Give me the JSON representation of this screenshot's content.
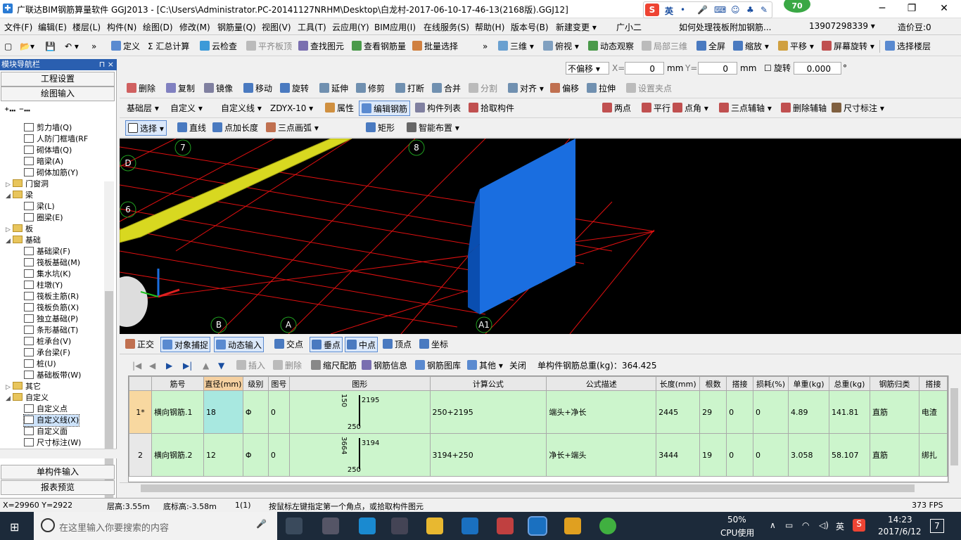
{
  "window": {
    "title": "广联达BIM钢筋算量软件 GGJ2013 - [C:\\Users\\Administrator.PC-20141127NRHM\\Desktop\\白龙村-2017-06-10-17-46-13(2168版).GGJ12]",
    "min": "─",
    "max": "❐",
    "close": "✕",
    "ime_logo": "S",
    "ime_lang": "英",
    "badge": "70"
  },
  "menu": [
    "文件(F)",
    "编辑(E)",
    "楼层(L)",
    "构件(N)",
    "绘图(D)",
    "修改(M)",
    "钢筋量(Q)",
    "视图(V)",
    "工具(T)",
    "云应用(Y)",
    "BIM应用(I)",
    "在线服务(S)",
    "帮助(H)",
    "版本号(B)",
    "新建变更 ▾",
    "广小二",
    "如何处理筏板附加钢筋...",
    "13907298339 ▾",
    "造价豆:0"
  ],
  "toolbar1": [
    "定义",
    "Σ 汇总计算",
    "云检查",
    "平齐板顶",
    "查找图元",
    "查看钢筋量",
    "批量选择",
    "三维 ▾",
    "俯视 ▾",
    "动态观察",
    "局部三维",
    "全屏",
    "缩放 ▾",
    "平移 ▾",
    "屏幕旋转 ▾",
    "选择楼层"
  ],
  "toolbar2": {
    "offset": "不偏移 ▾",
    "x_label": "X=",
    "x_val": "0",
    "y_label": "Y=",
    "y_val": "0",
    "unit": "mm",
    "rotate_label": "旋转",
    "rotate_val": "0.000",
    "deg": "°"
  },
  "toolbar3": [
    "删除",
    "复制",
    "镜像",
    "移动",
    "旋转",
    "延伸",
    "修剪",
    "打断",
    "合并",
    "分割",
    "对齐 ▾",
    "偏移",
    "拉伸",
    "设置夹点"
  ],
  "toolbar4": {
    "layer": "基础层",
    "type": "自定义",
    "sub": "自定义线",
    "code": "ZDYX-10",
    "items": [
      "属性",
      "编辑钢筋",
      "构件列表",
      "拾取构件",
      "两点",
      "平行",
      "点角 ▾",
      "三点辅轴 ▾",
      "删除辅轴",
      "尺寸标注 ▾"
    ]
  },
  "toolbar5": [
    "选择 ▾",
    "直线",
    "点加长度",
    "三点画弧 ▾",
    "矩形",
    "智能布置 ▾"
  ],
  "nav": {
    "title": "模块导航栏",
    "pin": "⊓ ×",
    "setup": "工程设置",
    "draw": "绘图输入",
    "single": "单构件输入",
    "report": "报表预览",
    "tree": [
      {
        "label": "剪力墙(Q)",
        "level": 2,
        "type": "item"
      },
      {
        "label": "人防门框墙(RF",
        "level": 2,
        "type": "item"
      },
      {
        "label": "砌体墙(Q)",
        "level": 2,
        "type": "item"
      },
      {
        "label": "暗梁(A)",
        "level": 2,
        "type": "item"
      },
      {
        "label": "砌体加筋(Y)",
        "level": 2,
        "type": "item"
      },
      {
        "label": "门窗洞",
        "level": 1,
        "type": "folder",
        "tw": "▷"
      },
      {
        "label": "梁",
        "level": 1,
        "type": "folder",
        "tw": "◢"
      },
      {
        "label": "梁(L)",
        "level": 2,
        "type": "item"
      },
      {
        "label": "圈梁(E)",
        "level": 2,
        "type": "item"
      },
      {
        "label": "板",
        "level": 1,
        "type": "folder",
        "tw": "▷"
      },
      {
        "label": "基础",
        "level": 1,
        "type": "folder",
        "tw": "◢"
      },
      {
        "label": "基础梁(F)",
        "level": 2,
        "type": "item"
      },
      {
        "label": "筏板基础(M)",
        "level": 2,
        "type": "item"
      },
      {
        "label": "集水坑(K)",
        "level": 2,
        "type": "item"
      },
      {
        "label": "柱墩(Y)",
        "level": 2,
        "type": "item"
      },
      {
        "label": "筏板主筋(R)",
        "level": 2,
        "type": "item"
      },
      {
        "label": "筏板负筋(X)",
        "level": 2,
        "type": "item"
      },
      {
        "label": "独立基础(P)",
        "level": 2,
        "type": "item"
      },
      {
        "label": "条形基础(T)",
        "level": 2,
        "type": "item"
      },
      {
        "label": "桩承台(V)",
        "level": 2,
        "type": "item"
      },
      {
        "label": "承台梁(F)",
        "level": 2,
        "type": "item"
      },
      {
        "label": "桩(U)",
        "level": 2,
        "type": "item"
      },
      {
        "label": "基础板带(W)",
        "level": 2,
        "type": "item"
      },
      {
        "label": "其它",
        "level": 1,
        "type": "folder",
        "tw": "▷"
      },
      {
        "label": "自定义",
        "level": 1,
        "type": "folder",
        "tw": "◢"
      },
      {
        "label": "自定义点",
        "level": 2,
        "type": "item"
      },
      {
        "label": "自定义线(X)",
        "level": 2,
        "type": "item",
        "selected": true
      },
      {
        "label": "自定义面",
        "level": 2,
        "type": "item"
      },
      {
        "label": "尺寸标注(W)",
        "level": 2,
        "type": "item"
      }
    ]
  },
  "canvas": {
    "axis_labels": [
      "7",
      "8",
      "D",
      "6",
      "B",
      "A",
      "A1"
    ]
  },
  "snap": [
    "正交",
    "对象捕捉",
    "动态输入",
    "交点",
    "垂点",
    "中点",
    "顶点",
    "坐标"
  ],
  "gridtoolbar": {
    "items": [
      "插入",
      "删除",
      "缩尺配筋",
      "钢筋信息",
      "钢筋图库",
      "其他 ▾",
      "关闭"
    ],
    "total": "单构件钢筋总重(kg)：364.425"
  },
  "table": {
    "headers": [
      "",
      "筋号",
      "直径(mm)",
      "级别",
      "图号",
      "图形",
      "计算公式",
      "公式描述",
      "长度(mm)",
      "根数",
      "搭接",
      "损耗(%)",
      "单重(kg)",
      "总重(kg)",
      "钢筋归类",
      "搭接"
    ],
    "rows": [
      {
        "idx": "1*",
        "name": "横向钢筋.1",
        "dia": "18",
        "grade": "Φ",
        "fig": "0",
        "shape_a": "150",
        "shape_b": "2195",
        "shape_c": "250",
        "formula": "250+2195",
        "desc": "端头+净长",
        "len": "2445",
        "count": "29",
        "lap": "0",
        "loss": "0",
        "unit": "4.89",
        "total": "141.81",
        "cat": "直筋",
        "lapt": "电渣"
      },
      {
        "idx": "2",
        "name": "横向钢筋.2",
        "dia": "12",
        "grade": "Φ",
        "fig": "0",
        "shape_a": "3664",
        "shape_b": "3194",
        "shape_c": "250",
        "formula": "3194+250",
        "desc": "净长+端头",
        "len": "3444",
        "count": "19",
        "lap": "0",
        "loss": "0",
        "unit": "3.058",
        "total": "58.107",
        "cat": "直筋",
        "lapt": "绑扎"
      }
    ]
  },
  "status": {
    "coords": "X=29960 Y=2922",
    "floor_h": "层高:3.55m",
    "bottom_h": "底标高:-3.58m",
    "count": "1(1)",
    "hint": "按鼠标左键指定第一个角点，或拾取构件图元",
    "fps": "373 FPS"
  },
  "taskbar": {
    "search": "在这里输入你要搜索的内容",
    "cpu_pct": "50%",
    "cpu_label": "CPU使用",
    "lang": "英",
    "time": "14:23",
    "date": "2017/6/12",
    "notif": "7"
  }
}
